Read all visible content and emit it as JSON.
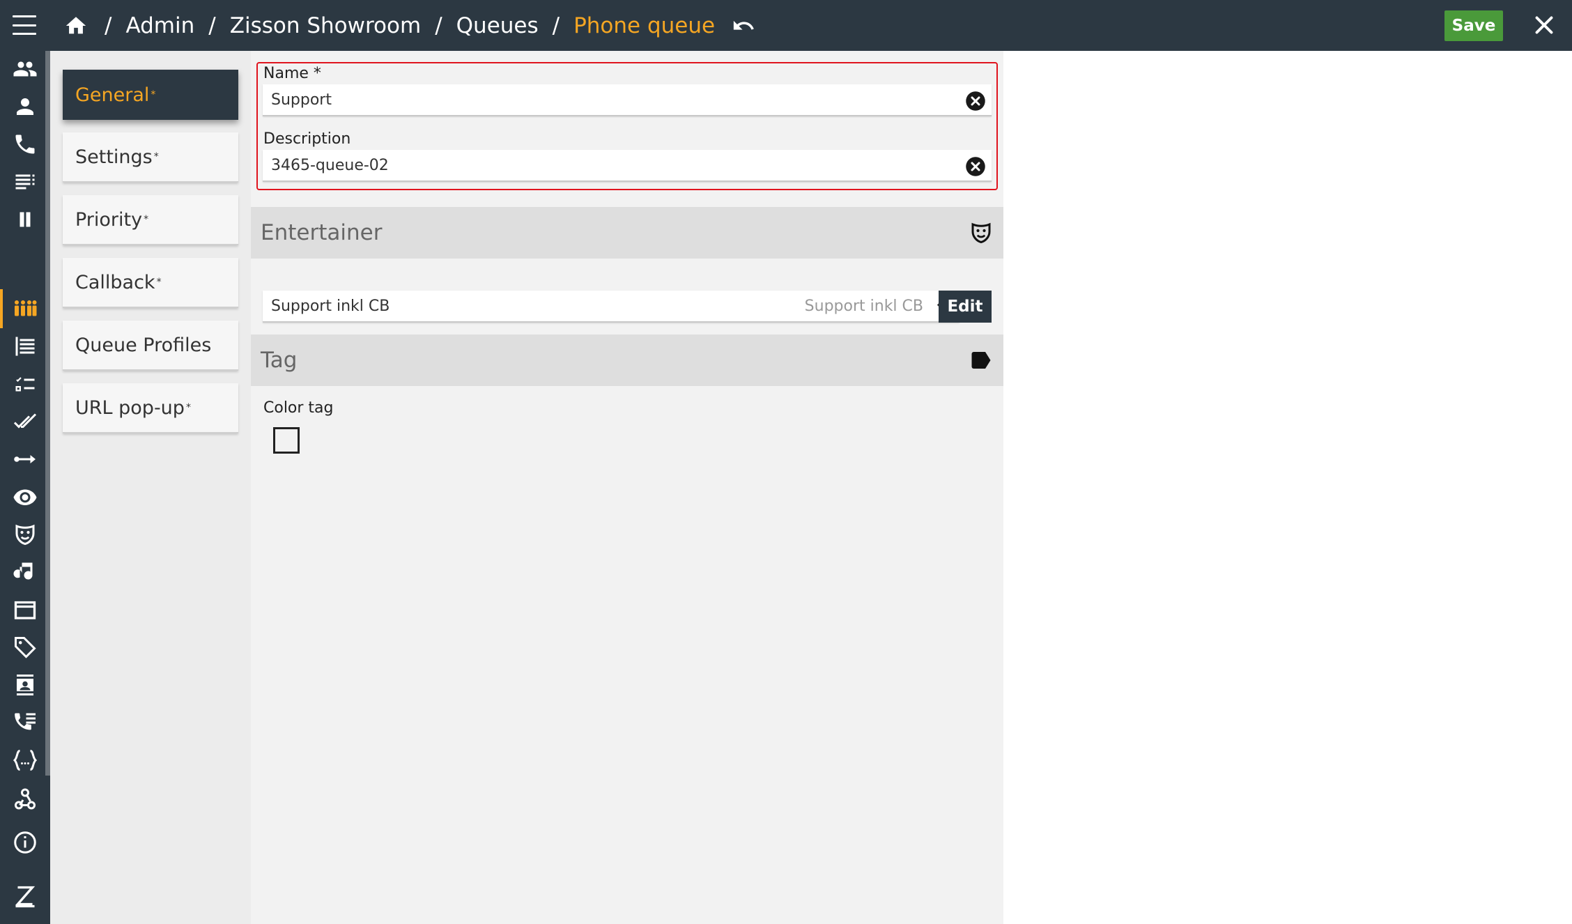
{
  "breadcrumbs": {
    "items": [
      "Admin",
      "Zisson Showroom",
      "Queues"
    ],
    "current": "Phone queue",
    "separator": "/"
  },
  "toolbar": {
    "save_label": "Save"
  },
  "sidebar": {
    "icons": [
      "users-icon",
      "user-icon",
      "phone-icon",
      "list-icon",
      "pause-icon",
      "queues-icon",
      "log-icon",
      "checklist-icon",
      "double-check-icon",
      "route-icon",
      "eye-icon",
      "entertainer-mask-icon",
      "music-icon",
      "folder-icon",
      "tags-icon",
      "contact-card-icon",
      "call-list-icon",
      "code-braces-icon",
      "webhook-icon",
      "info-icon",
      "zisson-logo-icon",
      "power-icon"
    ],
    "active": "queues-icon"
  },
  "tabs": [
    {
      "label": "General",
      "star": "*",
      "active": true
    },
    {
      "label": "Settings",
      "star": "*",
      "active": false
    },
    {
      "label": "Priority",
      "star": "*",
      "active": false
    },
    {
      "label": "Callback",
      "star": "*",
      "active": false
    },
    {
      "label": "Queue Profiles",
      "star": "",
      "active": false
    },
    {
      "label": "URL pop-up",
      "star": "*",
      "active": false
    }
  ],
  "form": {
    "name": {
      "label": "Name *",
      "value": "Support"
    },
    "description": {
      "label": "Description",
      "value": "3465-queue-02"
    }
  },
  "entertainer": {
    "section_title": "Entertainer",
    "selected": "Support inkl CB",
    "hint": "Support inkl CB",
    "edit_label": "Edit"
  },
  "tag": {
    "section_title": "Tag",
    "color_tag_label": "Color tag"
  },
  "colors": {
    "topbar": "#2c3842",
    "accent": "#f5a623",
    "save": "#4a9a3a",
    "error_border": "#e0141e"
  }
}
